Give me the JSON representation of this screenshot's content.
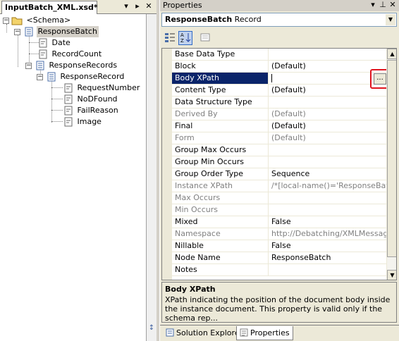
{
  "left": {
    "tab_title": "InputBatch_XML.xsd*",
    "tree": {
      "schema": "<Schema>",
      "response_batch": "ResponseBatch",
      "date": "Date",
      "record_count": "RecordCount",
      "response_records": "ResponseRecords",
      "response_record": "ResponseRecord",
      "request_number": "RequestNumber",
      "nod_found": "NoDFound",
      "fail_reason": "FailReason",
      "image": "Image"
    }
  },
  "properties": {
    "title": "Properties",
    "object_name": "ResponseBatch",
    "object_type": "Record",
    "rows": [
      {
        "name": "Base Data Type",
        "value": ""
      },
      {
        "name": "Block",
        "value": "(Default)"
      },
      {
        "name": "Body XPath",
        "value": ""
      },
      {
        "name": "Content Type",
        "value": "(Default)"
      },
      {
        "name": "Data Structure Type",
        "value": ""
      },
      {
        "name": "Derived By",
        "value": "(Default)"
      },
      {
        "name": "Final",
        "value": "(Default)"
      },
      {
        "name": "Form",
        "value": "(Default)"
      },
      {
        "name": "Group Max Occurs",
        "value": ""
      },
      {
        "name": "Group Min Occurs",
        "value": ""
      },
      {
        "name": "Group Order Type",
        "value": "Sequence"
      },
      {
        "name": "Instance XPath",
        "value": "/*[local-name()='ResponseBatch'"
      },
      {
        "name": "Max Occurs",
        "value": ""
      },
      {
        "name": "Min Occurs",
        "value": ""
      },
      {
        "name": "Mixed",
        "value": "False"
      },
      {
        "name": "Namespace",
        "value": "http://Debatching/XMLMessage"
      },
      {
        "name": "Nillable",
        "value": "False"
      },
      {
        "name": "Node Name",
        "value": "ResponseBatch"
      },
      {
        "name": "Notes",
        "value": ""
      }
    ],
    "ellipsis_label": "...",
    "description": {
      "title": "Body XPath",
      "text": "XPath indicating the position of the document body inside the instance document. This property is valid only if the schema rep..."
    }
  },
  "bottom_tabs": {
    "solution_explorer": "Solution Explorer",
    "properties": "Properties"
  }
}
